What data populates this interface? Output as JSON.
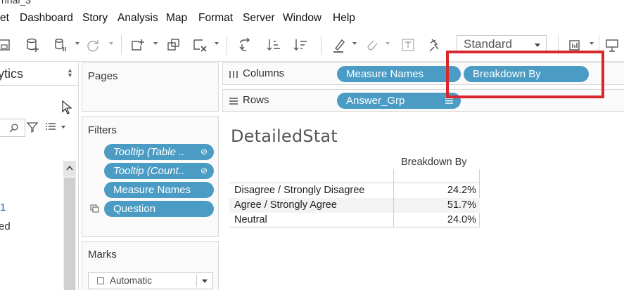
{
  "window": {
    "title_fragment": "rinal_3"
  },
  "menu": [
    "et",
    "Dashboard",
    "Story",
    "Analysis",
    "Map",
    "Format",
    "Server",
    "Window",
    "Help"
  ],
  "toolbar": {
    "icons": [
      "save-icon",
      "new-data-source-icon",
      "pause-updates-icon",
      "refresh-icon",
      "new-worksheet-icon",
      "duplicate-sheet-icon",
      "clear-sheet-icon",
      "swap-rows-columns-icon",
      "sort-ascending-icon",
      "sort-descending-icon",
      "highlight-icon",
      "group-members-icon",
      "labels-icon",
      "fix-axes-icon",
      "show-me-icon",
      "presentation-icon"
    ],
    "fit_select": "Standard"
  },
  "left_pane": {
    "title": "ytics",
    "link_text": "1",
    "item_text": "ed"
  },
  "cards": {
    "pages_title": "Pages",
    "filters_title": "Filters",
    "marks_title": "Marks",
    "marks_type": "Automatic",
    "filters": [
      {
        "label": "Tooltip (Table ..",
        "italic": true,
        "icon": "⊘"
      },
      {
        "label": "Tooltip (Count..",
        "italic": true,
        "icon": "⊘"
      },
      {
        "label": "Measure Names",
        "italic": false,
        "icon": ""
      },
      {
        "label": "Question",
        "italic": false,
        "icon": ""
      }
    ]
  },
  "shelves": {
    "columns_label": "Columns",
    "rows_label": "Rows",
    "columns_pills": [
      "Measure Names",
      "Breakdown By"
    ],
    "rows_pills": [
      "Answer_Grp"
    ]
  },
  "viz": {
    "title": "DetailedStat",
    "column_header": "Breakdown By",
    "rows": [
      {
        "label": "Disagree / Strongly Disagree",
        "value": "24.2%"
      },
      {
        "label": "Agree / Strongly Agree",
        "value": "51.7%"
      },
      {
        "label": "Neutral",
        "value": "24.0%"
      }
    ]
  },
  "colors": {
    "pill": "#4a9cc4",
    "highlight": "#d9272e",
    "link": "#1e5bb8"
  }
}
